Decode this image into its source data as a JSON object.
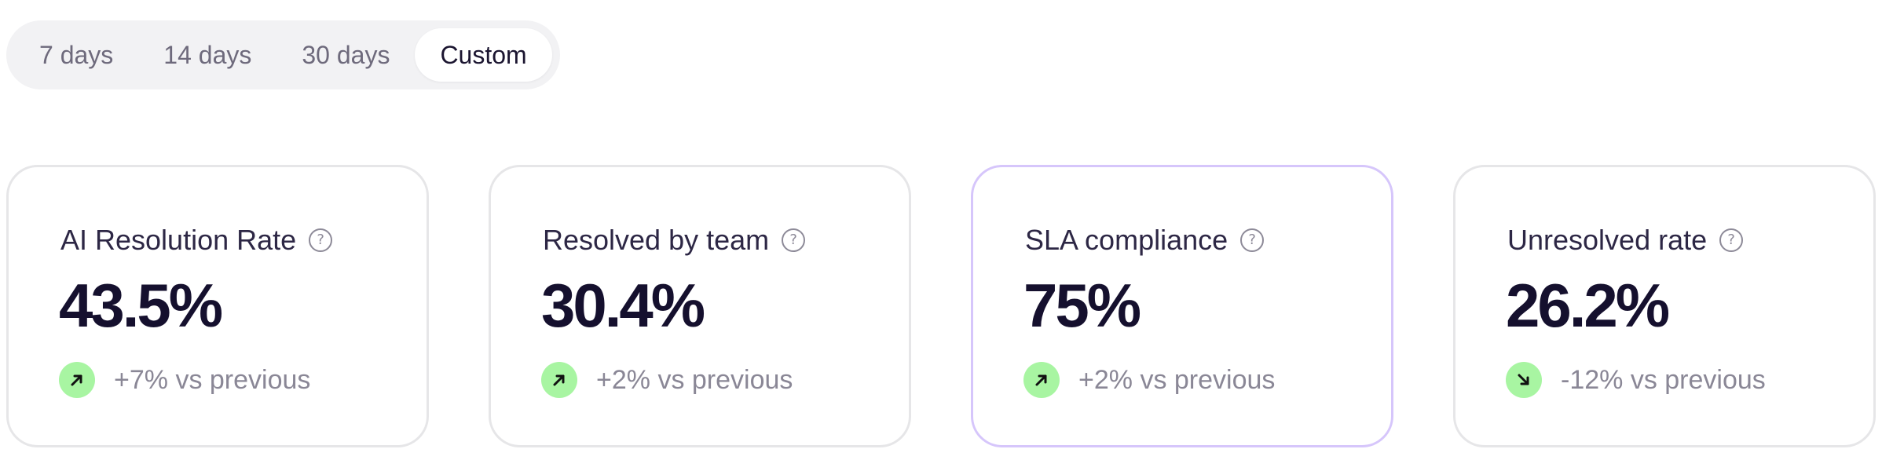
{
  "range_selector": {
    "options": [
      {
        "label": "7 days",
        "active": false
      },
      {
        "label": "14 days",
        "active": false
      },
      {
        "label": "30 days",
        "active": false
      },
      {
        "label": "Custom",
        "active": true
      }
    ]
  },
  "cards": [
    {
      "title": "AI Resolution Rate",
      "value": "43.5%",
      "trend_direction": "up",
      "trend_text": "+7% vs previous",
      "highlighted": false
    },
    {
      "title": "Resolved by team",
      "value": "30.4%",
      "trend_direction": "up",
      "trend_text": "+2% vs previous",
      "highlighted": false
    },
    {
      "title": "SLA compliance",
      "value": "75%",
      "trend_direction": "up",
      "trend_text": "+2% vs previous",
      "highlighted": true
    },
    {
      "title": "Unresolved rate",
      "value": "26.2%",
      "trend_direction": "down",
      "trend_text": "-12% vs previous",
      "highlighted": false
    }
  ],
  "icons": {
    "help": "question-circle-icon",
    "trend_up": "arrow-up-right-icon",
    "trend_down": "arrow-down-right-icon"
  },
  "colors": {
    "trend_badge_bg": "#a8f5a2",
    "highlight_border": "#d6c6fb",
    "card_border": "#e6e6e8",
    "segmented_bg": "#f2f2f4"
  }
}
